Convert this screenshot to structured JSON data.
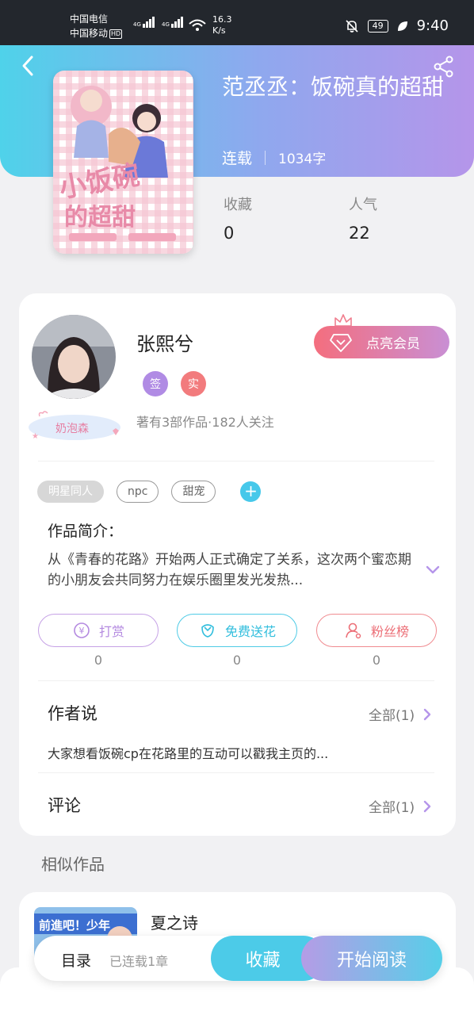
{
  "status_bar": {
    "carrier1": "中国电信",
    "carrier2": "中国移动",
    "hd": "HD",
    "net1": "4G",
    "net2": "4G",
    "speed_value": "16.3",
    "speed_unit": "K/s",
    "battery": "49",
    "time": "9:40"
  },
  "book": {
    "title": "范丞丞：饭碗真的超甜",
    "status": "连载",
    "words": "1034字",
    "stats": [
      {
        "label": "收藏",
        "value": "0"
      },
      {
        "label": "人气",
        "value": "22"
      }
    ]
  },
  "author": {
    "name": "张熙兮",
    "badge_sign": "签",
    "badge_real": "实",
    "nickname_badge": "奶泡森",
    "info": "著有3部作品·182人关注",
    "vip_button": "点亮会员"
  },
  "tags": [
    "明星同人",
    "npc",
    "甜宠"
  ],
  "intro": {
    "title": "作品简介：",
    "text": "从《青春的花路》开始两人正式确定了关系，这次两个蜜恋期的小朋友会共同努力在娱乐圈里发光发热..."
  },
  "actions": [
    {
      "label": "打赏",
      "count": "0"
    },
    {
      "label": "免费送花",
      "count": "0"
    },
    {
      "label": "粉丝榜",
      "count": "0"
    }
  ],
  "author_says": {
    "title": "作者说",
    "more": "全部(1)",
    "text": "大家想看饭碗cp在花路里的互动可以戳我主页的..."
  },
  "comments": {
    "title": "评论",
    "more": "全部(1)"
  },
  "similar": {
    "heading": "相似作品",
    "items": [
      {
        "title": "夏之诗",
        "cover_text": "前進吧！少年"
      }
    ]
  },
  "bottom_bar": {
    "toc": "目录",
    "toc_status": "已连载1章",
    "collect": "收藏",
    "read": "开始阅读"
  },
  "colors": {
    "header_gradient": [
      "#4fd2ea",
      "#8fa8ee",
      "#b595ea"
    ],
    "accent_blue": "#4ccbe8",
    "accent_purple": "#b08be4",
    "accent_red": "#f27b7d"
  }
}
